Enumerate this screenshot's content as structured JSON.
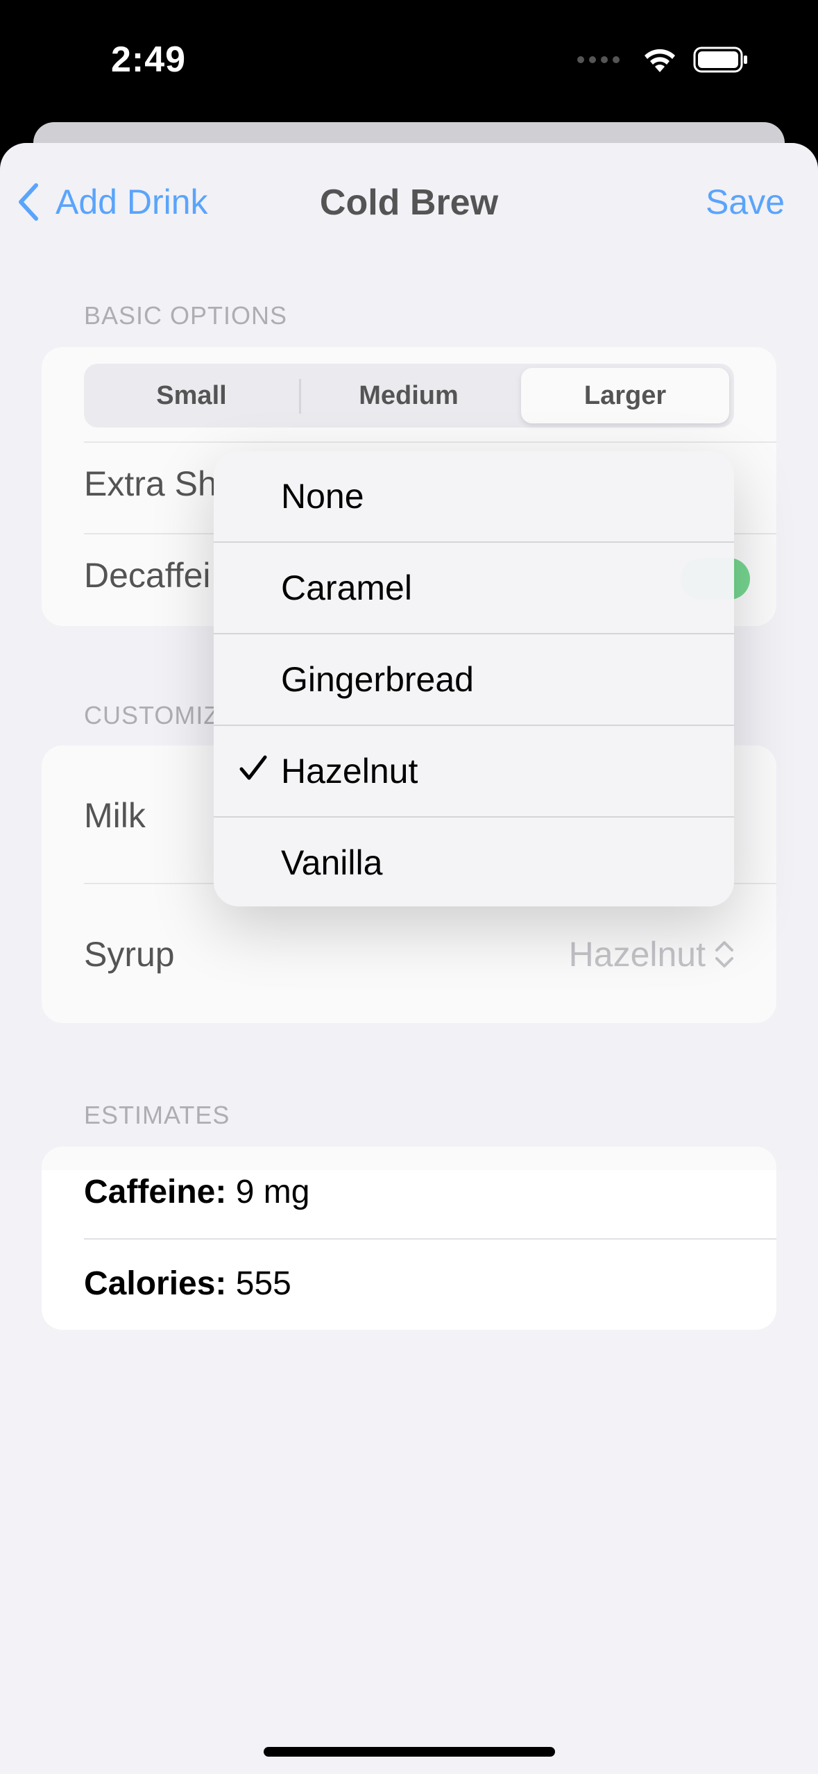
{
  "status_bar": {
    "time": "2:49"
  },
  "nav": {
    "back_label": "Add Drink",
    "title": "Cold Brew",
    "save_label": "Save"
  },
  "basic_options": {
    "header": "BASIC OPTIONS",
    "sizes": [
      "Small",
      "Medium",
      "Larger"
    ],
    "selected_size": "Larger",
    "extra_shot_label": "Extra Sh",
    "decaf_label": "Decaffei",
    "decaf_on": true
  },
  "customize": {
    "header": "CUSTOMIZ",
    "milk_label": "Milk",
    "syrup_label": "Syrup",
    "syrup_value": "Hazelnut"
  },
  "estimates": {
    "header": "ESTIMATES",
    "caffeine_label": "Caffeine:",
    "caffeine_value": "9 mg",
    "calories_label": "Calories:",
    "calories_value": "555"
  },
  "syrup_menu": {
    "options": [
      "None",
      "Caramel",
      "Gingerbread",
      "Hazelnut",
      "Vanilla"
    ],
    "selected": "Hazelnut"
  },
  "colors": {
    "accent": "#0a7cff",
    "toggle_on": "#34c759",
    "background": "#f2f2f7"
  }
}
